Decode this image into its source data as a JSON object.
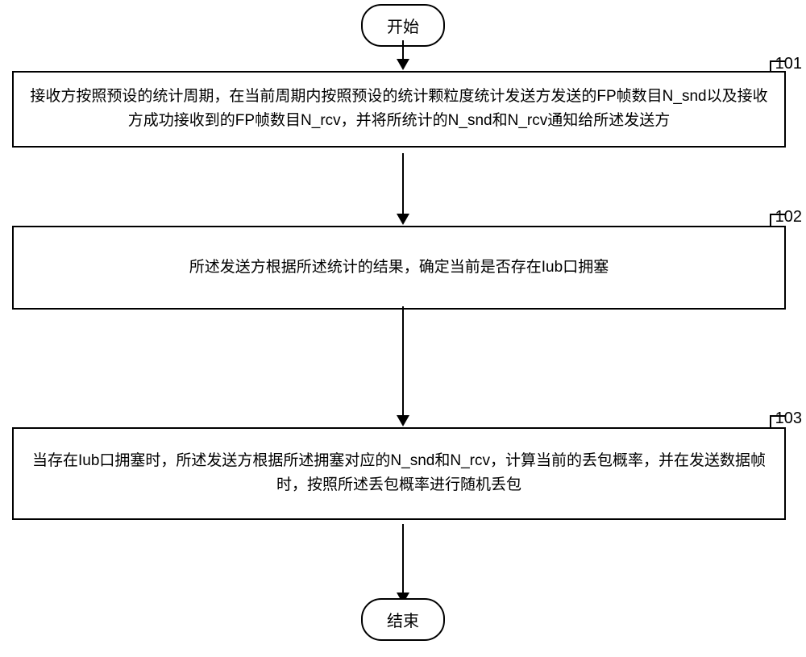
{
  "flowchart": {
    "start": "开始",
    "end": "结束",
    "steps": {
      "step101": {
        "label": "101",
        "text": "接收方按照预设的统计周期，在当前周期内按照预设的统计颗粒度统计发送方发送的FP帧数目N_snd以及接收方成功接收到的FP帧数目N_rcv，并将所统计的N_snd和N_rcv通知给所述发送方"
      },
      "step102": {
        "label": "102",
        "text": "所述发送方根据所述统计的结果，确定当前是否存在Iub口拥塞"
      },
      "step103": {
        "label": "103",
        "text": "当存在Iub口拥塞时，所述发送方根据所述拥塞对应的N_snd和N_rcv，计算当前的丢包概率，并在发送数据帧时，按照所述丢包概率进行随机丢包"
      }
    }
  }
}
